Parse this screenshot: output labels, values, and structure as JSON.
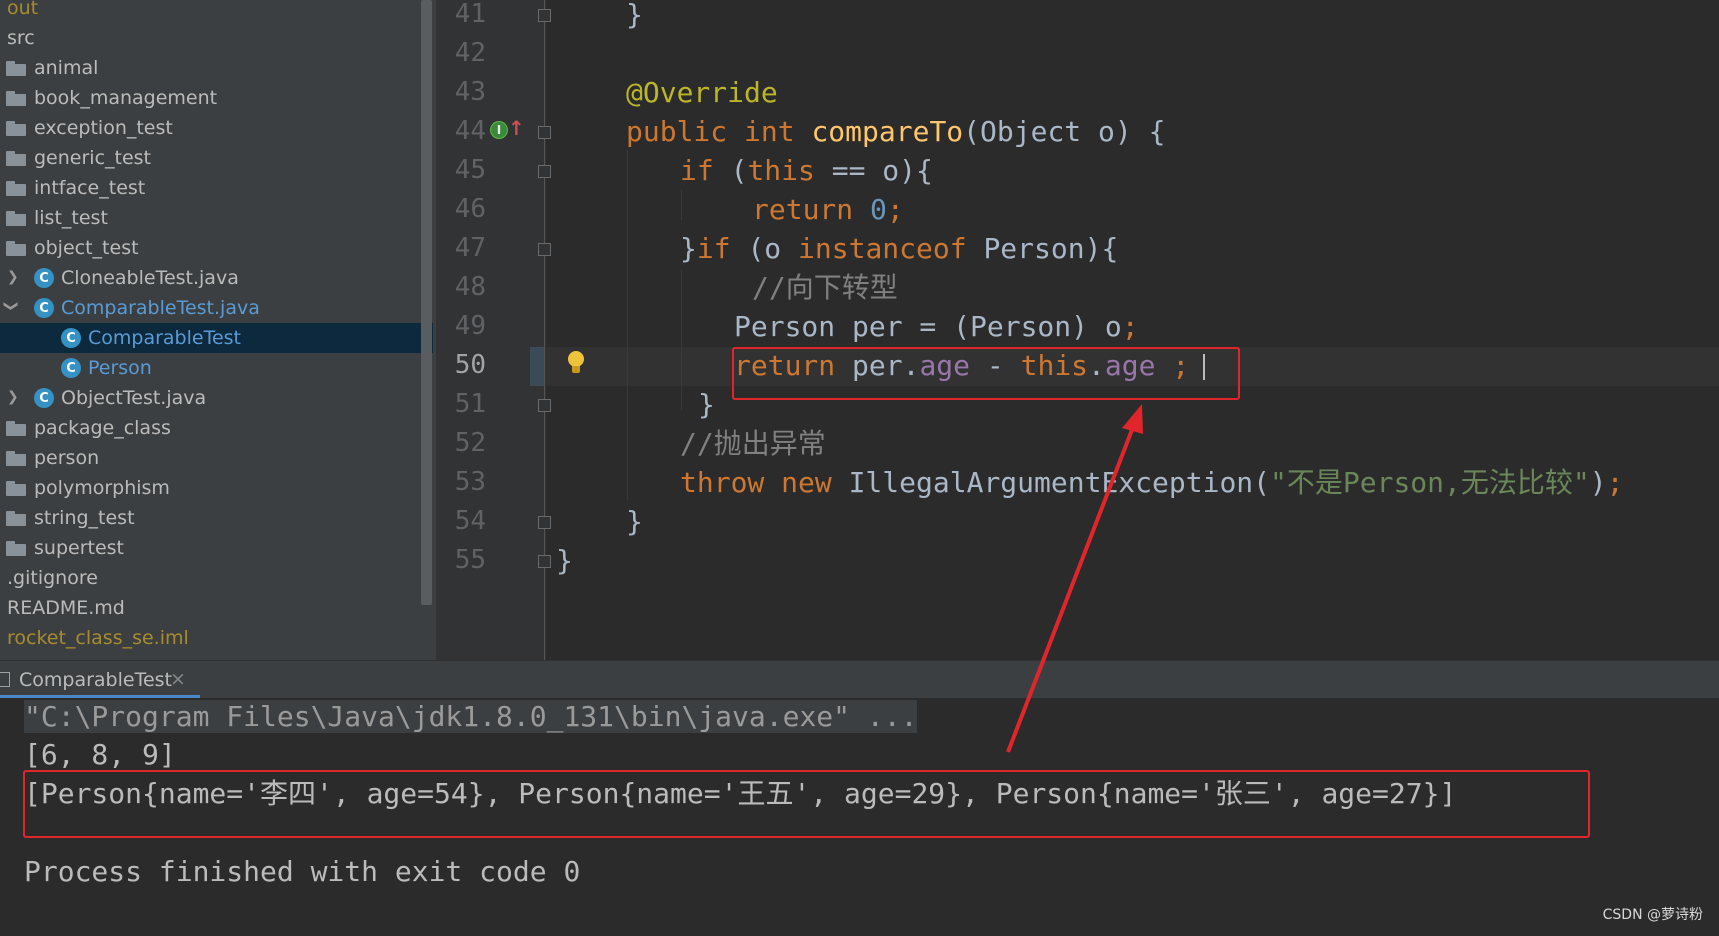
{
  "project_tree": {
    "items": [
      {
        "label": "out",
        "kind": "folder-excluded",
        "color": "#a78c2f"
      },
      {
        "label": "src",
        "kind": "source-root"
      },
      {
        "label": "animal",
        "kind": "package"
      },
      {
        "label": "book_management",
        "kind": "package"
      },
      {
        "label": "exception_test",
        "kind": "package"
      },
      {
        "label": "generic_test",
        "kind": "package"
      },
      {
        "label": "intface_test",
        "kind": "package"
      },
      {
        "label": "list_test",
        "kind": "package"
      },
      {
        "label": "object_test",
        "kind": "package"
      },
      {
        "label": "CloneableTest.java",
        "kind": "java-file",
        "expanded": false
      },
      {
        "label": "ComparableTest.java",
        "kind": "java-file",
        "expanded": true,
        "color": "#5b9bd5"
      },
      {
        "label": "ComparableTest",
        "kind": "class",
        "selected": true,
        "color": "#5b9bd5"
      },
      {
        "label": "Person",
        "kind": "class",
        "color": "#5b9bd5"
      },
      {
        "label": "ObjectTest.java",
        "kind": "java-file",
        "expanded": false
      },
      {
        "label": "package_class",
        "kind": "package"
      },
      {
        "label": "person",
        "kind": "package"
      },
      {
        "label": "polymorphism",
        "kind": "package"
      },
      {
        "label": "string_test",
        "kind": "package"
      },
      {
        "label": "supertest",
        "kind": "package"
      },
      {
        "label": ".gitignore",
        "kind": "file"
      },
      {
        "label": "README.md",
        "kind": "file"
      },
      {
        "label": "rocket_class_se.iml",
        "kind": "file",
        "color": "#a78c2f"
      }
    ]
  },
  "editor": {
    "current_line": 50,
    "lines": [
      {
        "n": "41",
        "tokens": [
          [
            "txt",
            "}"
          ]
        ],
        "x": 0
      },
      {
        "n": "42",
        "tokens": []
      },
      {
        "n": "43",
        "tokens": [
          [
            "ann",
            "@Override"
          ]
        ]
      },
      {
        "n": "44",
        "tokens": [
          [
            "kw",
            "public int "
          ],
          [
            "fn",
            "compareTo"
          ],
          [
            "txt",
            "(Object o) {"
          ]
        ]
      },
      {
        "n": "45",
        "tokens": [
          [
            "kw",
            "if "
          ],
          [
            "txt",
            "("
          ],
          [
            "kw",
            "this "
          ],
          [
            "txt",
            "== o){"
          ]
        ]
      },
      {
        "n": "46",
        "tokens": [
          [
            "kw",
            "return "
          ],
          [
            "num",
            "0"
          ],
          [
            "kw",
            ";"
          ]
        ]
      },
      {
        "n": "47",
        "tokens": [
          [
            "txt",
            "}"
          ],
          [
            "kw",
            "if "
          ],
          [
            "txt",
            "(o "
          ],
          [
            "kw",
            "instanceof "
          ],
          [
            "txt",
            "Person){"
          ]
        ]
      },
      {
        "n": "48",
        "tokens": [
          [
            "cmt",
            "//向下转型"
          ]
        ]
      },
      {
        "n": "49",
        "tokens": [
          [
            "txt",
            "Person per = (Person) o"
          ],
          [
            "kw",
            ";"
          ]
        ]
      },
      {
        "n": "50",
        "tokens": [
          [
            "kw",
            "return "
          ],
          [
            "txt",
            "per."
          ],
          [
            "field",
            "age"
          ],
          [
            "txt",
            " - "
          ],
          [
            "kw",
            "this"
          ],
          [
            "txt",
            "."
          ],
          [
            "field",
            "age"
          ],
          [
            "txt",
            " "
          ],
          [
            "kw",
            ";"
          ]
        ]
      },
      {
        "n": "51",
        "tokens": [
          [
            "txt",
            "}"
          ]
        ]
      },
      {
        "n": "52",
        "tokens": [
          [
            "cmt",
            "//抛出异常"
          ]
        ]
      },
      {
        "n": "53",
        "tokens": [
          [
            "kw",
            "throw new "
          ],
          [
            "txt",
            "IllegalArgumentException("
          ],
          [
            "str",
            "\"不是Person,无法比较\""
          ],
          [
            "txt",
            ")"
          ],
          [
            "kw",
            ";"
          ]
        ]
      },
      {
        "n": "54",
        "tokens": [
          [
            "txt",
            "}"
          ]
        ]
      },
      {
        "n": "55",
        "tokens": [
          [
            "txt",
            "}"
          ]
        ]
      }
    ]
  },
  "run_panel": {
    "tab_label": "ComparableTest",
    "close_glyph": "×",
    "console_lines": [
      "\"C:\\Program Files\\Java\\jdk1.8.0_131\\bin\\java.exe\" ...",
      "[6, 8, 9]",
      "[Person{name='李四', age=54}, Person{name='王五', age=29}, Person{name='张三', age=27}]",
      "",
      "Process finished with exit code 0"
    ]
  },
  "watermark": "CSDN @萝诗粉",
  "colors": {
    "annotation_red": "#e0262b",
    "selection": "#0d293e",
    "keyword": "#cc7832",
    "string": "#6a8759"
  }
}
